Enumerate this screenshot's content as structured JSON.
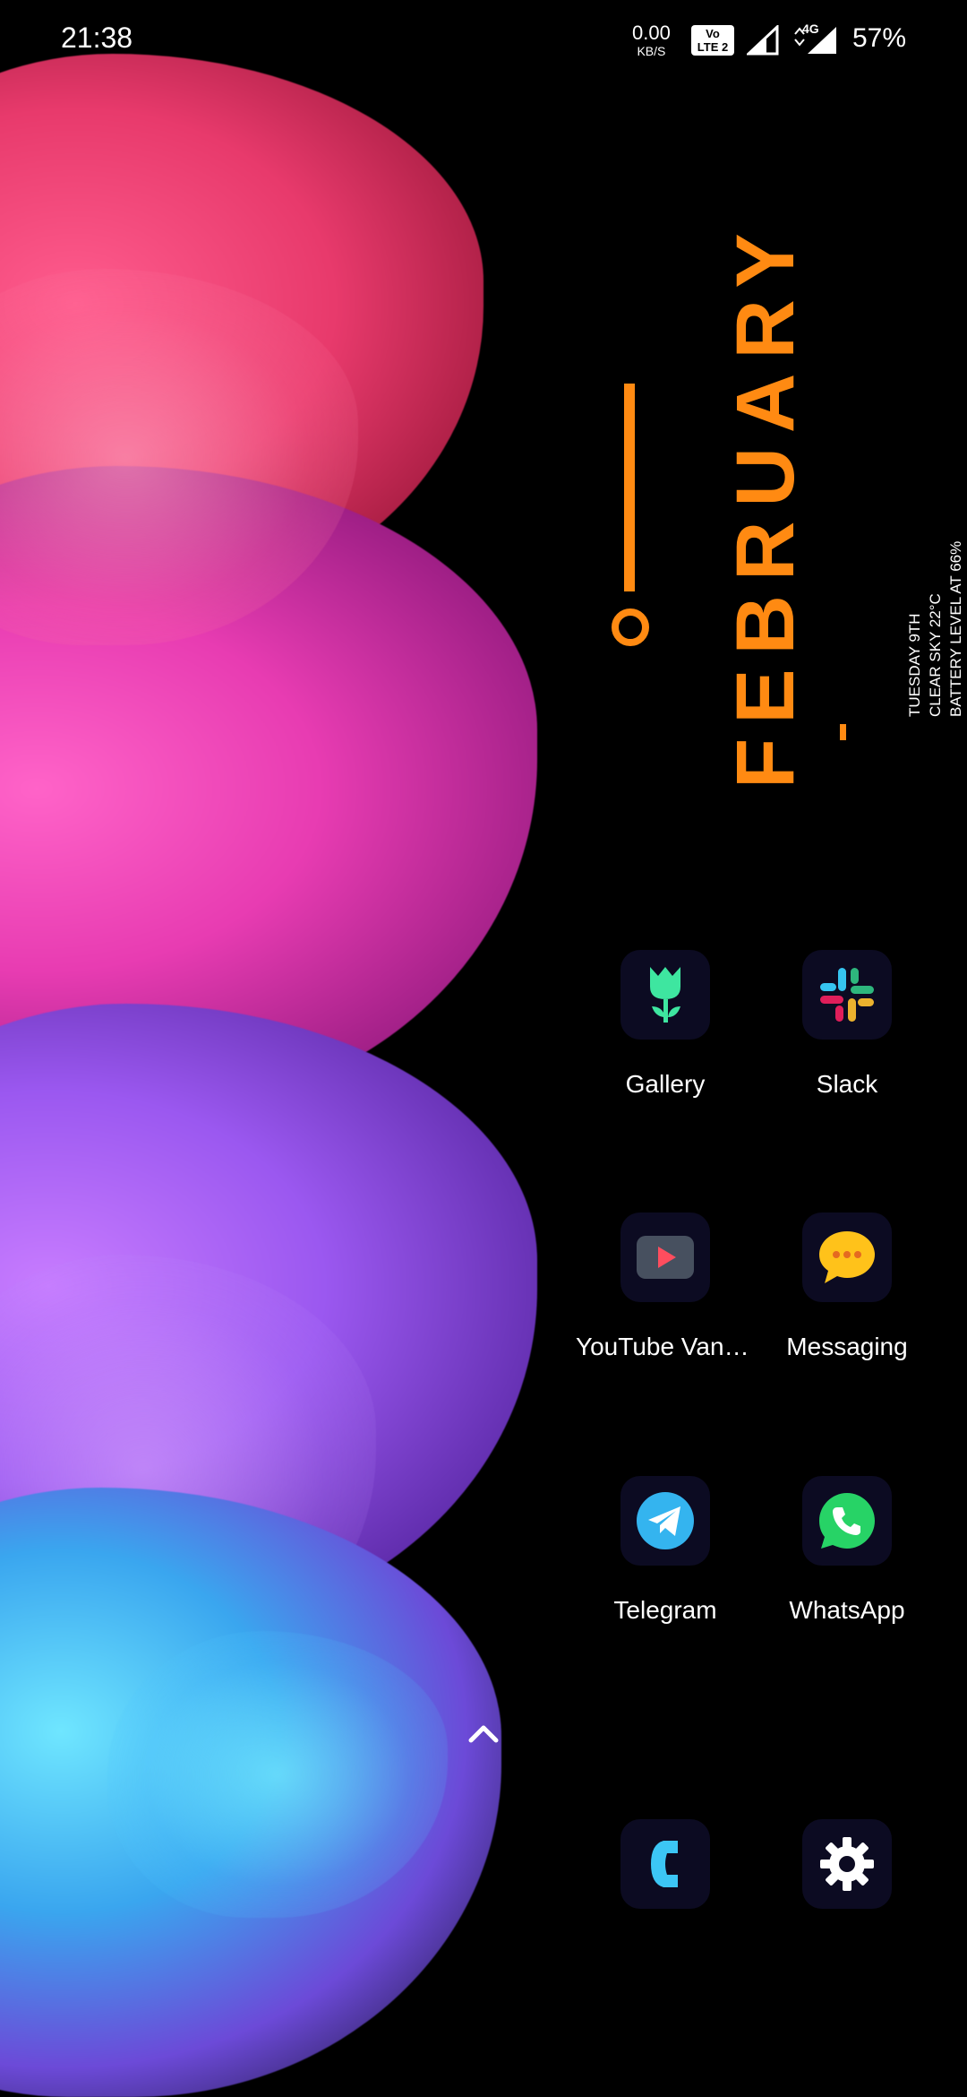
{
  "status_bar": {
    "time": "21:38",
    "net_speed_value": "0.00",
    "net_speed_unit": "KB/S",
    "volte_line1": "Vo",
    "volte_line2": "LTE 2",
    "network_type": "4G",
    "battery": "57%"
  },
  "widget": {
    "month": "FEBRUARY",
    "info": [
      "TUESDAY 9TH",
      "CLEAR SKY 22°C",
      "BATTERY LEVEL AT 66%"
    ],
    "accent_color": "#ff8a12"
  },
  "apps": {
    "gallery": {
      "label": "Gallery",
      "icon": "tulip-icon"
    },
    "slack": {
      "label": "Slack",
      "icon": "slack-icon"
    },
    "youtube": {
      "label": "YouTube Vanc…",
      "icon": "youtube-play-icon"
    },
    "messaging": {
      "label": "Messaging",
      "icon": "chat-bubble-icon"
    },
    "telegram": {
      "label": "Telegram",
      "icon": "paper-plane-icon"
    },
    "whatsapp": {
      "label": "WhatsApp",
      "icon": "whatsapp-phone-icon"
    },
    "phone": {
      "icon": "phone-icon"
    },
    "settings": {
      "icon": "gear-icon"
    }
  },
  "drawer": {
    "icon": "chevron-up-icon"
  }
}
